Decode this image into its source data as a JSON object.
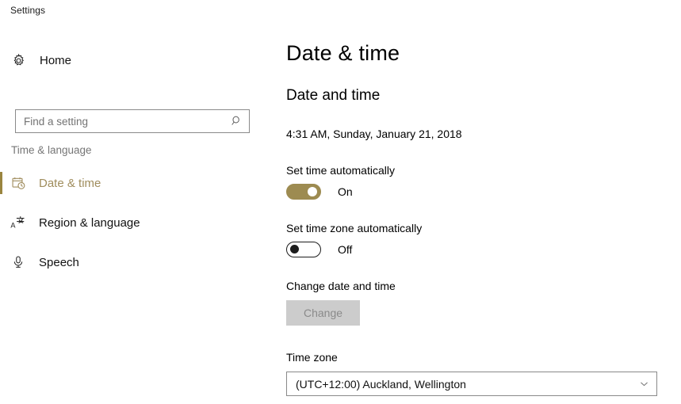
{
  "window": {
    "title": "Settings"
  },
  "sidebar": {
    "home": {
      "label": "Home",
      "icon": "gear-icon"
    },
    "search": {
      "placeholder": "Find a setting",
      "value": "",
      "icon": "search-icon"
    },
    "group_header": "Time & language",
    "items": [
      {
        "label": "Date & time",
        "icon": "calendar-clock-icon",
        "selected": true
      },
      {
        "label": "Region & language",
        "icon": "language-translate-icon",
        "selected": false
      },
      {
        "label": "Speech",
        "icon": "microphone-icon",
        "selected": false
      }
    ]
  },
  "main": {
    "page_title": "Date & time",
    "section_title": "Date and time",
    "datetime_readout": "4:31 AM, Sunday, January 21, 2018",
    "set_time_automatically": {
      "label": "Set time automatically",
      "state": "On",
      "on": true
    },
    "set_timezone_automatically": {
      "label": "Set time zone automatically",
      "state": "Off",
      "on": false
    },
    "change_date_and_time": {
      "label": "Change date and time",
      "button_label": "Change",
      "disabled": true
    },
    "time_zone": {
      "label": "Time zone",
      "value": "(UTC+12:00) Auckland, Wellington",
      "chevron": "chevron-down-icon"
    }
  },
  "colors": {
    "accent": "#9a853f",
    "accent_text": "#a08d5d",
    "toggle_on": "#9d8b51",
    "muted_text": "#767676",
    "border": "#8a8a8a",
    "disabled_bg": "#cccccc",
    "disabled_text": "#8a8a8a"
  }
}
